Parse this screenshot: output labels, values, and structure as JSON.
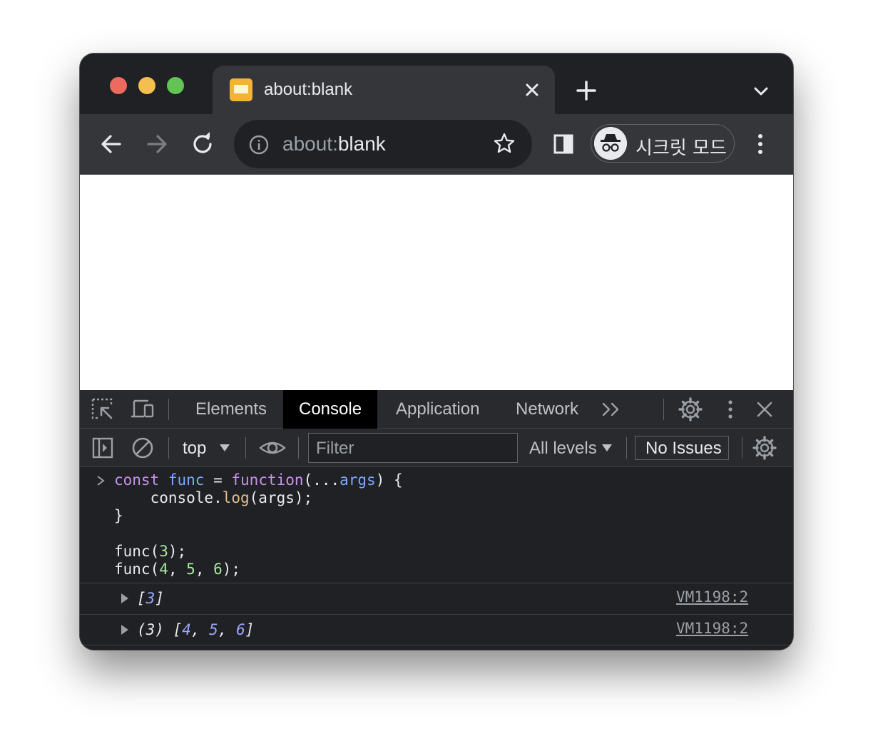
{
  "tab": {
    "title": "about:blank"
  },
  "omnibox": {
    "scheme": "about:",
    "host": "blank"
  },
  "profile": {
    "label": "시크릿 모드"
  },
  "devtools": {
    "tabs": [
      "Elements",
      "Console",
      "Application",
      "Network"
    ],
    "active_tab": "Console",
    "context": "top",
    "filter_placeholder": "Filter",
    "levels": "All levels",
    "issues": "No Issues"
  },
  "console": {
    "outputs": [
      {
        "open": "[",
        "values": [
          "3"
        ],
        "close": "]",
        "source": "VM1198:2"
      },
      {
        "prefix": "(3) [",
        "values": [
          "4",
          "5",
          "6"
        ],
        "close": "]",
        "source": "VM1198:2"
      }
    ]
  },
  "colors": {
    "window_bg": "#202124",
    "toolbar_bg": "#35363a",
    "devtools_bg": "#292a2d",
    "keyword": "#c792ea",
    "variable": "#7cacf8",
    "function": "#e2c08d",
    "number": "#a8e6a0",
    "output_number": "#9ca7ff"
  }
}
